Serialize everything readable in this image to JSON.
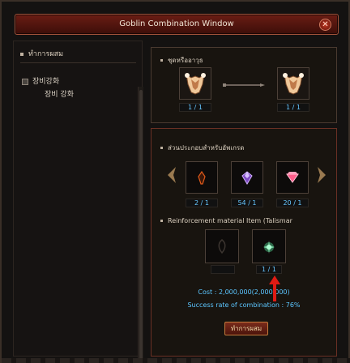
{
  "window": {
    "title": "Goblin Combination Window",
    "close_glyph": "✕"
  },
  "left_panel": {
    "header": "ทำการผสม",
    "tree": {
      "parent": "장비강화",
      "child": "장비 강화"
    }
  },
  "top_section": {
    "title": "ชุดหรืออาวุธ",
    "source_count": "1 / 1",
    "result_count": "1 / 1",
    "source_icon": "armor-icon",
    "result_icon": "armor-icon"
  },
  "upgrade_section": {
    "title": "ส่วนประกอบสำหรับอัพเกรด",
    "materials": [
      {
        "icon": "orange-gem-icon",
        "count": "2 / 1",
        "color": "#e05a1a"
      },
      {
        "icon": "purple-gem-icon",
        "count": "54 / 1",
        "color": "#b07be6"
      },
      {
        "icon": "pink-gem-icon",
        "count": "20 / 1",
        "color": "#ff5c8a"
      }
    ]
  },
  "reinforcement_section": {
    "title": "Reinforcement material Item (Talismar",
    "slot1_icon": "talisman-placeholder-icon",
    "slot2_icon": "talisman-green-icon",
    "slot2_count": "1 / 1"
  },
  "summary": {
    "cost": "Cost : 2,000,000(2,000,000)",
    "rate": "Success rate of combination : 76%"
  },
  "combine_button": "ทำการผสม",
  "colors": {
    "accent_blue": "#5cc6ff",
    "title_red": "#6b1d14",
    "red_arrow": "#e01b14"
  }
}
